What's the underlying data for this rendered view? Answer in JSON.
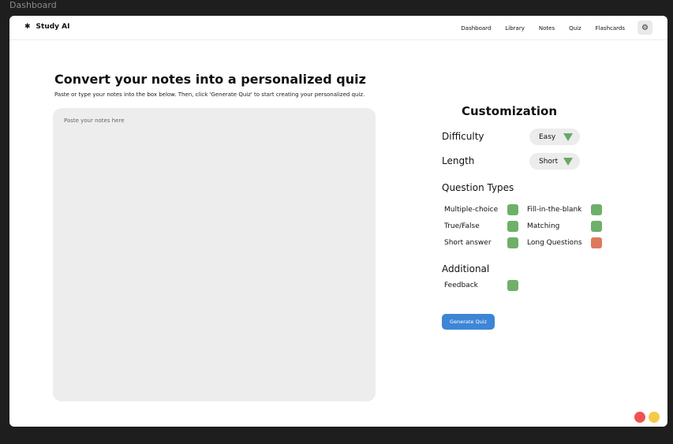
{
  "frame": {
    "label": "Dashboard"
  },
  "navbar": {
    "brand": "Study AI",
    "brand_icon": "asterisk-logo-icon",
    "links": [
      "Dashboard",
      "Library",
      "Notes",
      "Quiz",
      "Flashcards"
    ],
    "settings_icon": "gear-icon"
  },
  "main": {
    "title": "Convert your notes into a personalized quiz",
    "subtitle": "Paste or type your notes into the box below. Then, click 'Generate Quiz' to start creating your personalized quiz.",
    "notes_placeholder": "Paste your notes here",
    "notes_value": ""
  },
  "customization": {
    "title": "Customization",
    "difficulty": {
      "label": "Difficulty",
      "value": "Easy"
    },
    "length": {
      "label": "Length",
      "value": "Short"
    },
    "question_types": {
      "title": "Question Types",
      "options": [
        {
          "label": "Multiple-choice",
          "checked": true
        },
        {
          "label": "Fill-in-the-blank",
          "checked": true
        },
        {
          "label": "True/False",
          "checked": true
        },
        {
          "label": "Matching",
          "checked": true
        },
        {
          "label": "Short answer",
          "checked": true
        },
        {
          "label": "Long Questions",
          "checked": false
        }
      ]
    },
    "additional": {
      "title": "Additional",
      "options": [
        {
          "label": "Feedback",
          "checked": true
        }
      ]
    },
    "generate_label": "Generate Quiz"
  },
  "colors": {
    "checked": "#6eb06a",
    "unchecked": "#dc7a5e",
    "primary": "#3d86d6",
    "dot_red": "#ef5350",
    "dot_yellow": "#f7c948"
  }
}
